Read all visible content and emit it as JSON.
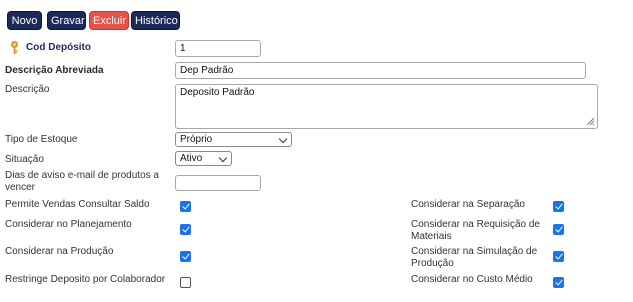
{
  "toolbar": {
    "novo": "Novo",
    "gravar": "Gravar",
    "excluir": "Excluir",
    "historico": "Histórico",
    "colors": {
      "primary": "#1b2a5b",
      "danger": "#e4534a"
    }
  },
  "form": {
    "cod_deposito": {
      "label": "Cod Depósito",
      "value": "1",
      "icon": "key-icon"
    },
    "descricao_abreviada": {
      "label": "Descrição Abreviada",
      "value": "Dep Padrão"
    },
    "descricao": {
      "label": "Descrição",
      "value": "Deposito Padrão"
    },
    "tipo_estoque": {
      "label": "Tipo de Estoque",
      "value": "Próprio"
    },
    "situacao": {
      "label": "Situação",
      "value": "Ativo"
    },
    "dias_aviso": {
      "label": "Dias de aviso e-mail de produtos a vencer",
      "value": ""
    }
  },
  "checkboxes_left": [
    {
      "label": "Permite Vendas Consultar Saldo",
      "checked": true
    },
    {
      "label": "Considerar no Planejamento",
      "checked": true
    },
    {
      "label": "Considerar na Produção",
      "checked": true
    },
    {
      "label": "Restringe Deposito por Colaborador",
      "checked": false
    }
  ],
  "checkboxes_right": [
    {
      "label": "Considerar na Separação",
      "checked": true
    },
    {
      "label": "Considerar na Requisição de Materiais",
      "checked": true
    },
    {
      "label": "Considerar na Simulação de Produção",
      "checked": true
    },
    {
      "label": "Considerar no Custo Médio",
      "checked": true
    }
  ],
  "accent_color": "#1a73e8"
}
